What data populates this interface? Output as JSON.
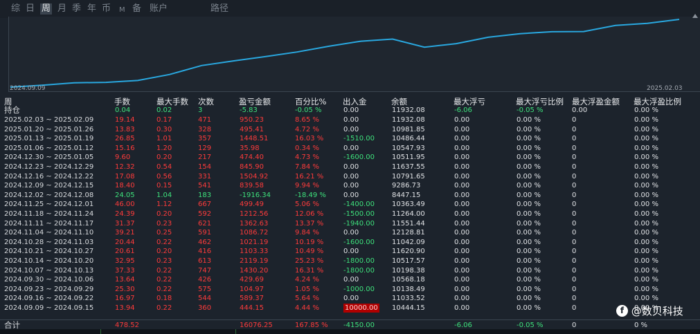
{
  "tabs": [
    {
      "label": "综",
      "active": false
    },
    {
      "label": "日",
      "active": false
    },
    {
      "label": "周",
      "active": true
    },
    {
      "label": "月",
      "active": false
    },
    {
      "label": "季",
      "active": false
    },
    {
      "label": "年",
      "active": false
    },
    {
      "label": "币",
      "active": false
    },
    {
      "label": "M",
      "active": false
    },
    {
      "label": "备",
      "active": false
    },
    {
      "label": "账户",
      "active": false
    },
    {
      "label": "路径",
      "active": false
    }
  ],
  "chart": {
    "start_date": "2024.09.09",
    "end_date": "2025.02.03",
    "line_color": "#29a8e0",
    "balance_series": [
      10444.15,
      10568.18,
      10138.49,
      11033.52,
      10517.57,
      10198.38,
      11620.9,
      11042.09,
      12128.81,
      11551.44,
      11264.0,
      10363.49,
      8447.15,
      9286.73,
      10791.65,
      11637.55,
      10511.95,
      10547.93,
      10486.44,
      10981.85,
      11932.08
    ]
  },
  "headers": [
    "周",
    "手数",
    "最大手数",
    "次数",
    "盈亏金额",
    "百分比%",
    "出入金",
    "余额",
    "最大浮亏",
    "最大浮亏比例",
    "最大浮盈金额",
    "最大浮盈比例"
  ],
  "position_row": {
    "label": "持仓",
    "lots": "0.04",
    "max_lots": "0.02",
    "count": "3",
    "pnl": "-5.83",
    "pct": "-0.05 %",
    "flow": "0.00",
    "balance": "11932.08",
    "max_float_loss": "-6.06",
    "max_float_loss_pct": "-0.05 %",
    "max_float_profit": "0.00",
    "max_float_profit_pct": "0.00 %"
  },
  "rows": [
    {
      "label": "2025.02.03 ~ 2025.02.09",
      "lots": "19.14",
      "max_lots": "0.17",
      "count": "471",
      "pnl": "950.23",
      "pct": "8.65 %",
      "flow": "0.00",
      "balance": "11932.08",
      "mfl": "0.00",
      "mflp": "0.00 %",
      "mfp": "0",
      "mfpp": "0.00 %",
      "color": "red",
      "flow_color": "white"
    },
    {
      "label": "2025.01.20 ~ 2025.01.26",
      "lots": "13.83",
      "max_lots": "0.30",
      "count": "328",
      "pnl": "495.41",
      "pct": "4.72 %",
      "flow": "0.00",
      "balance": "10981.85",
      "mfl": "0.00",
      "mflp": "0.00 %",
      "mfp": "0",
      "mfpp": "0.00 %",
      "color": "red",
      "flow_color": "white"
    },
    {
      "label": "2025.01.13 ~ 2025.01.19",
      "lots": "26.85",
      "max_lots": "1.01",
      "count": "357",
      "pnl": "1448.51",
      "pct": "16.03 %",
      "flow": "-1510.00",
      "balance": "10486.44",
      "mfl": "0.00",
      "mflp": "0.00 %",
      "mfp": "0",
      "mfpp": "0.00 %",
      "color": "red",
      "flow_color": "green"
    },
    {
      "label": "2025.01.06 ~ 2025.01.12",
      "lots": "15.16",
      "max_lots": "1.20",
      "count": "129",
      "pnl": "35.98",
      "pct": "0.34 %",
      "flow": "0.00",
      "balance": "10547.93",
      "mfl": "0.00",
      "mflp": "0.00 %",
      "mfp": "0",
      "mfpp": "0.00 %",
      "color": "red",
      "flow_color": "white"
    },
    {
      "label": "2024.12.30 ~ 2025.01.05",
      "lots": "9.60",
      "max_lots": "0.20",
      "count": "217",
      "pnl": "474.40",
      "pct": "4.73 %",
      "flow": "-1600.00",
      "balance": "10511.95",
      "mfl": "0.00",
      "mflp": "0.00 %",
      "mfp": "0",
      "mfpp": "0.00 %",
      "color": "red",
      "flow_color": "green"
    },
    {
      "label": "2024.12.23 ~ 2024.12.29",
      "lots": "12.32",
      "max_lots": "0.54",
      "count": "154",
      "pnl": "845.90",
      "pct": "7.84 %",
      "flow": "0.00",
      "balance": "11637.55",
      "mfl": "0.00",
      "mflp": "0.00 %",
      "mfp": "0",
      "mfpp": "0.00 %",
      "color": "red",
      "flow_color": "white"
    },
    {
      "label": "2024.12.16 ~ 2024.12.22",
      "lots": "17.08",
      "max_lots": "0.56",
      "count": "331",
      "pnl": "1504.92",
      "pct": "16.21 %",
      "flow": "0.00",
      "balance": "10791.65",
      "mfl": "0.00",
      "mflp": "0.00 %",
      "mfp": "0",
      "mfpp": "0.00 %",
      "color": "red",
      "flow_color": "white"
    },
    {
      "label": "2024.12.09 ~ 2024.12.15",
      "lots": "18.40",
      "max_lots": "0.15",
      "count": "541",
      "pnl": "839.58",
      "pct": "9.94 %",
      "flow": "0.00",
      "balance": "9286.73",
      "mfl": "0.00",
      "mflp": "0.00 %",
      "mfp": "0",
      "mfpp": "0.00 %",
      "color": "red",
      "flow_color": "white"
    },
    {
      "label": "2024.12.02 ~ 2024.12.08",
      "lots": "24.05",
      "max_lots": "1.04",
      "count": "183",
      "pnl": "-1916.34",
      "pct": "-18.49 %",
      "flow": "0.00",
      "balance": "8447.15",
      "mfl": "0.00",
      "mflp": "0.00 %",
      "mfp": "0",
      "mfpp": "0.00 %",
      "color": "green",
      "flow_color": "white"
    },
    {
      "label": "2024.11.25 ~ 2024.12.01",
      "lots": "46.00",
      "max_lots": "1.12",
      "count": "667",
      "pnl": "499.49",
      "pct": "5.06 %",
      "flow": "-1400.00",
      "balance": "10363.49",
      "mfl": "0.00",
      "mflp": "0.00 %",
      "mfp": "0",
      "mfpp": "0.00 %",
      "color": "red",
      "flow_color": "green"
    },
    {
      "label": "2024.11.18 ~ 2024.11.24",
      "lots": "24.39",
      "max_lots": "0.20",
      "count": "592",
      "pnl": "1212.56",
      "pct": "12.06 %",
      "flow": "-1500.00",
      "balance": "11264.00",
      "mfl": "0.00",
      "mflp": "0.00 %",
      "mfp": "0",
      "mfpp": "0.00 %",
      "color": "red",
      "flow_color": "green"
    },
    {
      "label": "2024.11.11 ~ 2024.11.17",
      "lots": "31.37",
      "max_lots": "0.23",
      "count": "621",
      "pnl": "1362.63",
      "pct": "13.37 %",
      "flow": "-1940.00",
      "balance": "11551.44",
      "mfl": "0.00",
      "mflp": "0.00 %",
      "mfp": "0",
      "mfpp": "0.00 %",
      "color": "red",
      "flow_color": "green"
    },
    {
      "label": "2024.11.04 ~ 2024.11.10",
      "lots": "39.21",
      "max_lots": "0.25",
      "count": "591",
      "pnl": "1086.72",
      "pct": "9.84 %",
      "flow": "0.00",
      "balance": "12128.81",
      "mfl": "0.00",
      "mflp": "0.00 %",
      "mfp": "0",
      "mfpp": "0.00 %",
      "color": "red",
      "flow_color": "white"
    },
    {
      "label": "2024.10.28 ~ 2024.11.03",
      "lots": "20.44",
      "max_lots": "0.22",
      "count": "462",
      "pnl": "1021.19",
      "pct": "10.19 %",
      "flow": "-1600.00",
      "balance": "11042.09",
      "mfl": "0.00",
      "mflp": "0.00 %",
      "mfp": "0",
      "mfpp": "0.00 %",
      "color": "red",
      "flow_color": "green"
    },
    {
      "label": "2024.10.21 ~ 2024.10.27",
      "lots": "20.61",
      "max_lots": "0.20",
      "count": "416",
      "pnl": "1103.33",
      "pct": "10.49 %",
      "flow": "0.00",
      "balance": "11620.90",
      "mfl": "0.00",
      "mflp": "0.00 %",
      "mfp": "0",
      "mfpp": "0.00 %",
      "color": "red",
      "flow_color": "white"
    },
    {
      "label": "2024.10.14 ~ 2024.10.20",
      "lots": "32.95",
      "max_lots": "0.23",
      "count": "613",
      "pnl": "2119.19",
      "pct": "25.23 %",
      "flow": "-1800.00",
      "balance": "10517.57",
      "mfl": "0.00",
      "mflp": "0.00 %",
      "mfp": "0",
      "mfpp": "0.00 %",
      "color": "red",
      "flow_color": "green"
    },
    {
      "label": "2024.10.07 ~ 2024.10.13",
      "lots": "37.33",
      "max_lots": "0.22",
      "count": "747",
      "pnl": "1430.20",
      "pct": "16.31 %",
      "flow": "-1800.00",
      "balance": "10198.38",
      "mfl": "0.00",
      "mflp": "0.00 %",
      "mfp": "0",
      "mfpp": "0.00 %",
      "color": "red",
      "flow_color": "green"
    },
    {
      "label": "2024.09.30 ~ 2024.10.06",
      "lots": "13.64",
      "max_lots": "0.22",
      "count": "426",
      "pnl": "429.69",
      "pct": "4.24 %",
      "flow": "0.00",
      "balance": "10568.18",
      "mfl": "0.00",
      "mflp": "0.00 %",
      "mfp": "0",
      "mfpp": "0.00 %",
      "color": "red",
      "flow_color": "white"
    },
    {
      "label": "2024.09.23 ~ 2024.09.29",
      "lots": "25.30",
      "max_lots": "0.22",
      "count": "575",
      "pnl": "104.97",
      "pct": "1.05 %",
      "flow": "-1000.00",
      "balance": "10138.49",
      "mfl": "0.00",
      "mflp": "0.00 %",
      "mfp": "0",
      "mfpp": "0.00 %",
      "color": "red",
      "flow_color": "green"
    },
    {
      "label": "2024.09.16 ~ 2024.09.22",
      "lots": "16.97",
      "max_lots": "0.18",
      "count": "544",
      "pnl": "589.37",
      "pct": "5.64 %",
      "flow": "0.00",
      "balance": "11033.52",
      "mfl": "0.00",
      "mflp": "0.00 %",
      "mfp": "0",
      "mfpp": "0.00 %",
      "color": "red",
      "flow_color": "white"
    },
    {
      "label": "2024.09.09 ~ 2024.09.15",
      "lots": "13.94",
      "max_lots": "0.22",
      "count": "360",
      "pnl": "444.15",
      "pct": "4.44 %",
      "flow": "10000.00",
      "balance": "10444.15",
      "mfl": "0.00",
      "mflp": "0.00 %",
      "mfp": "0",
      "mfpp": "0.00 %",
      "color": "red",
      "flow_color": "redbg"
    }
  ],
  "totals": {
    "label": "合计",
    "lots": "478.52",
    "pnl": "16076.25",
    "pct": "167.85 %",
    "flow": "-4150.00",
    "mfl": "-6.06",
    "mflp": "-0.05 %",
    "mfp": "0",
    "mfpp": "0 %"
  },
  "watermark": {
    "icon": "facebook-icon",
    "text": "@数贝科技"
  }
}
